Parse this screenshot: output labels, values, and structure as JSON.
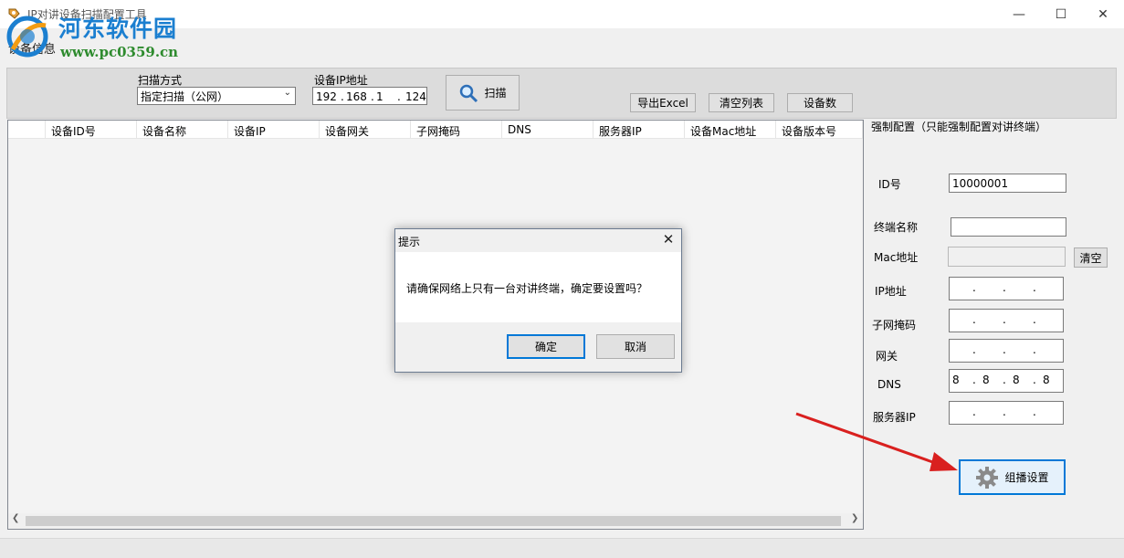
{
  "window": {
    "title": "IP对讲设备扫描配置工具",
    "minimize_icon": "minimize-icon",
    "maximize_icon": "maximize-icon",
    "close_icon": "close-icon"
  },
  "watermark": {
    "title": "河东软件园",
    "url": "www.pc0359.cn"
  },
  "menu": {
    "device_info": "设备信息"
  },
  "toolbar": {
    "scan_mode_label": "扫描方式",
    "scan_mode_value": "指定扫描（公网）",
    "device_ip_label": "设备IP地址",
    "device_ip_parts": [
      "192",
      "168",
      "1",
      "124"
    ],
    "scan_button": "扫描",
    "export_button": "导出Excel",
    "clear_button": "清空列表",
    "device_count_button": "设备数"
  },
  "table": {
    "columns": [
      "",
      "设备ID号",
      "设备名称",
      "设备IP",
      "设备网关",
      "子网掩码",
      "DNS",
      "服务器IP",
      "设备Mac地址",
      "设备版本号"
    ],
    "rows": []
  },
  "right_panel": {
    "title": "强制配置（只能强制配置对讲终端）",
    "id_label": "ID号",
    "id_value": "10000001",
    "terminal_name_label": "终端名称",
    "terminal_name_value": "",
    "mac_label": "Mac地址",
    "mac_value": "",
    "clear_button": "清空",
    "ip_label": "IP地址",
    "subnet_label": "子网掩码",
    "gateway_label": "网关",
    "dns_label": "DNS",
    "dns_parts": [
      "8",
      "8",
      "8",
      "8"
    ],
    "server_ip_label": "服务器IP",
    "multicast_button": "组播设置"
  },
  "dialog": {
    "title": "提示",
    "message": "请确保网络上只有一台对讲终端，确定要设置吗？",
    "ok_button": "确定",
    "cancel_button": "取消"
  },
  "colors": {
    "accent": "#0078d7",
    "annotation_arrow": "#d9201f",
    "watermark_blue": "#1b7fd0",
    "watermark_green": "#2e8b2e"
  }
}
